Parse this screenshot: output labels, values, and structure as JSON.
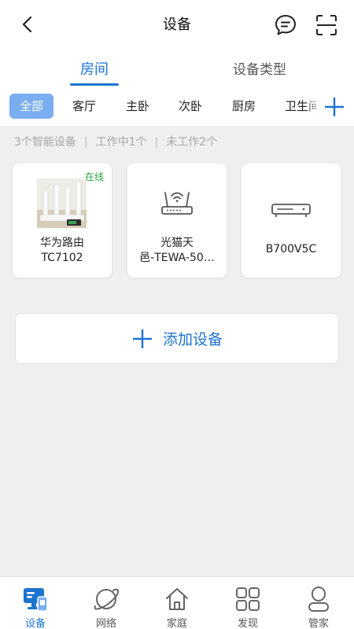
{
  "header": {
    "title": "设备",
    "back_icon": "chevron-left-icon",
    "message_icon": "message-icon",
    "scan_icon": "scan-icon"
  },
  "tabs": [
    {
      "label": "房间",
      "active": true
    },
    {
      "label": "设备类型",
      "active": false
    }
  ],
  "rooms": [
    {
      "label": "全部",
      "active": true
    },
    {
      "label": "客厅"
    },
    {
      "label": "主卧"
    },
    {
      "label": "次卧"
    },
    {
      "label": "厨房"
    },
    {
      "label": "卫生间"
    }
  ],
  "summary": {
    "total": "3个智能设备",
    "working": "工作中1个",
    "idle": "未工作2个"
  },
  "devices": [
    {
      "name_line1": "华为路由",
      "name_line2": "TC7102",
      "status": "在线",
      "icon": "router-photo"
    },
    {
      "name_line1": "光猫天",
      "name_line2": "邑-TEWA-50…",
      "icon": "wifi-router-icon"
    },
    {
      "name_line1": "B700V5C",
      "icon": "set-top-box-icon"
    }
  ],
  "add_device": {
    "label": "添加设备",
    "icon": "plus-icon"
  },
  "bottom_nav": [
    {
      "label": "设备",
      "icon": "device-icon",
      "active": true
    },
    {
      "label": "网络",
      "icon": "planet-icon"
    },
    {
      "label": "家庭",
      "icon": "home-icon"
    },
    {
      "label": "发现",
      "icon": "grid-icon"
    },
    {
      "label": "管家",
      "icon": "butler-icon"
    }
  ],
  "colors": {
    "accent": "#1d73d0",
    "chip_active": "#7aaef0",
    "online": "#22a83a",
    "background": "#efefef"
  }
}
